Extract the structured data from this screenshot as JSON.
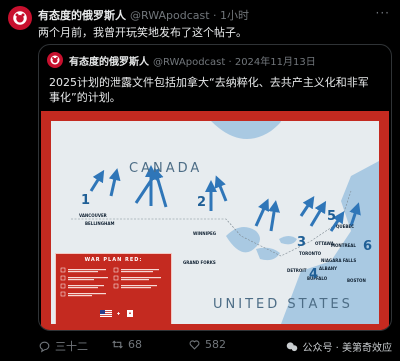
{
  "tweet": {
    "author_name": "有态度的俄罗斯人",
    "handle_time": "@RWApodcast · 1小时",
    "more_icon": "more-icon",
    "text": "两个月前，我曾开玩笑地发布了这个帖子。",
    "quoted": {
      "author_name": "有态度的俄罗斯人",
      "handle_date": "@RWApodcast · 2024年11月13日",
      "text": "2025计划的泄露文件包括加拿大“去纳粹化、去共产主义化和非军事化”的计划。",
      "image": {
        "region_labels": {
          "canada": "CANADA",
          "usa": "UNITED STATES"
        },
        "cities": {
          "vancouver": "VANCOUVER",
          "bellingham": "BELLINGHAM",
          "winnipeg": "WINNIPEG",
          "grand_forks": "GRAND FORKS",
          "toronto": "TORONTO",
          "detroit": "DETROIT",
          "buffalo": "BUFFALO",
          "montreal": "MONTREAL",
          "quebec": "QUEBEC",
          "albany": "ALBANY",
          "boston": "BOSTON",
          "ottawa": "OTTAWA",
          "niagara": "NIAGARA FALLS"
        },
        "numbers": [
          "1",
          "2",
          "3",
          "4",
          "5",
          "6"
        ],
        "legend_title": "WAR PLAN RED:"
      }
    },
    "actions": {
      "reply_count": "三十二",
      "retweet_count": "68",
      "like_count": "582"
    },
    "watermark": "公众号 · 美第奇效应"
  },
  "colors": {
    "accent_red": "#c42a20",
    "map_water": "#a9c9e2",
    "map_land": "#e7ecef",
    "arrow_blue": "#2f76b8"
  }
}
